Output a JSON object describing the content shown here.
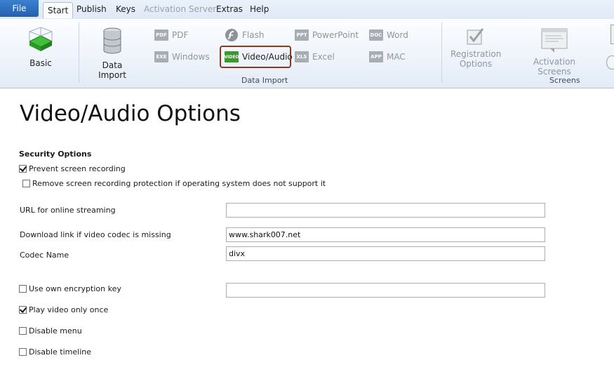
{
  "tabs": {
    "file": "File",
    "start": "Start",
    "publish": "Publish",
    "keys": "Keys",
    "activation_server": "Activation Server",
    "extras": "Extras",
    "help": "Help"
  },
  "ribbon": {
    "basic": "Basic",
    "data_import": "Data Import",
    "formats": {
      "pdf": {
        "badge": "PDF",
        "label": "PDF"
      },
      "windows": {
        "badge": "EXE",
        "label": "Windows"
      },
      "flash": {
        "label": "Flash"
      },
      "video_audio": {
        "badge": "VIDEO",
        "label": "Video/Audio"
      },
      "powerpoint": {
        "badge": "PPT",
        "label": "PowerPoint"
      },
      "excel": {
        "badge": "XLS",
        "label": "Excel"
      },
      "word": {
        "badge": "DOC",
        "label": "Word"
      },
      "mac": {
        "badge": "APP",
        "label": "MAC"
      }
    },
    "group_data_import": "Data Import",
    "registration_options_1": "Registration",
    "registration_options_2": "Options",
    "activation_screens": "Activation Screens",
    "group_screens": "Screens"
  },
  "page": {
    "title": "Video/Audio Options",
    "security_heading": "Security Options",
    "prevent_recording": "Prevent screen recording",
    "remove_protection": "Remove screen recording protection if operating system does not support it",
    "url_streaming_label": "URL for online streaming",
    "url_streaming_value": "",
    "download_link_label": "Download link if video codec is missing",
    "download_link_value": "www.shark007.net",
    "codec_name_label": "Codec Name",
    "codec_name_value": "divx",
    "own_key_label": "Use own encryption key",
    "own_key_value": "",
    "play_once_label": "Play video only once",
    "disable_menu_label": "Disable menu",
    "disable_timeline_label": "Disable timeline"
  },
  "states": {
    "prevent_recording": true,
    "remove_protection": false,
    "own_key": false,
    "play_once": true,
    "disable_menu": false,
    "disable_timeline": false
  },
  "colors": {
    "file_button": "#2a6cc0",
    "highlight_border": "#8b3a1f",
    "video_icon": "#3a9a2f"
  }
}
